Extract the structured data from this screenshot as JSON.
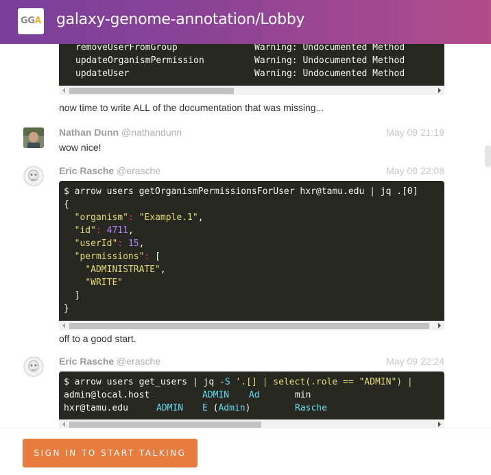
{
  "header": {
    "logo_text_main": "GG",
    "logo_text_accent": "A",
    "room_title": "galaxy-genome-annotation/Lobby"
  },
  "messages": [
    {
      "code": [
        {
          "left": "removeUserFromGroup",
          "right": "Warning: Undocumented Method"
        },
        {
          "left": "updateOrganismPermission",
          "right": "Warning: Undocumented Method"
        },
        {
          "left": "updateUser",
          "right": "Warning: Undocumented Method"
        }
      ],
      "text": "now time to write ALL of the documentation that was missing..."
    },
    {
      "author_name": "Nathan Dunn",
      "author_user": "@nathandunn",
      "time": "May 09 21:19",
      "text": "wow nice!"
    },
    {
      "author_name": "Eric Rasche",
      "author_user": "@erasche",
      "time": "May 09 22:08",
      "code": {
        "command": "$ arrow users getOrganismPermissionsForUser hxr@tamu.edu | jq .[0]",
        "open_brace": "{",
        "k_organism": "\"organism\"",
        "v_organism": "\"Example.1\"",
        "k_id": "\"id\"",
        "v_id": "4711",
        "k_userId": "\"userId\"",
        "v_userId": "15",
        "k_permissions": "\"permissions\"",
        "v_perm1": "\"ADMINISTRATE\"",
        "v_perm2": "\"WRITE\"",
        "close_bracket": "]",
        "close_brace": "}"
      },
      "text": "off to a good start."
    },
    {
      "author_name": "Eric Rasche",
      "author_user": "@erasche",
      "time": "May 09 22:24",
      "code": {
        "command_pre": "$ arrow users get_users | jq -",
        "command_flag": "S",
        "command_str": " '.[] | select(.role == \"ADMIN\") |",
        "row1_email": "admin@local.host",
        "row1_role": "ADMIN",
        "row1_first": "Ad",
        "row1_last": "min",
        "row2_email": "hxr@tamu.edu",
        "row2_role": "ADMIN",
        "row2_first": "E",
        "row2_paren": "Admin",
        "row2_last": "Rasche"
      }
    }
  ],
  "footer": {
    "signin_label": "SIGN IN TO START TALKING"
  }
}
